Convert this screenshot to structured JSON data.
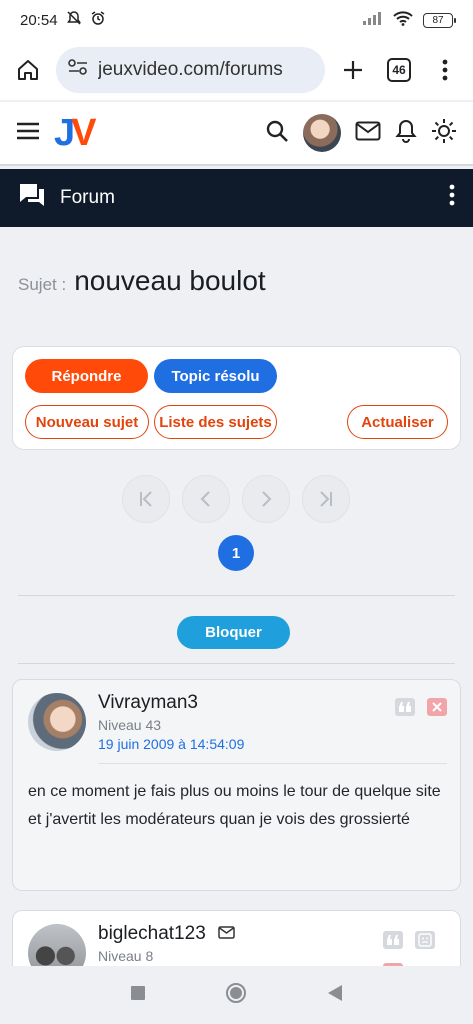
{
  "status_bar": {
    "time": "20:54",
    "battery": "87"
  },
  "browser": {
    "url": "jeuxvideo.com/forums",
    "tab_count": "46"
  },
  "site": {
    "logo_j": "J",
    "logo_v": "V"
  },
  "forum_bar": {
    "label": "Forum"
  },
  "topic": {
    "prefix": "Sujet :",
    "title": "nouveau boulot"
  },
  "actions": {
    "reply": "Répondre",
    "resolved": "Topic résolu",
    "new_topic": "Nouveau sujet",
    "topic_list": "Liste des sujets",
    "refresh": "Actualiser"
  },
  "pagination": {
    "current_page": "1"
  },
  "block_label": "Bloquer",
  "posts": [
    {
      "author": "Vivrayman3",
      "level": "Niveau 43",
      "date": "19 juin 2009 à 14:54:09",
      "body": "en ce moment je fais plus ou moins le tour de quelque site et j'avertit les modérateurs quan je vois des grossierté"
    },
    {
      "author": "biglechat123",
      "level": "Niveau 8"
    }
  ],
  "colors": {
    "orange": "#ff4a0a",
    "blue": "#1f6fe3",
    "navy": "#0f1a2a",
    "cyan": "#1fa0dc"
  }
}
